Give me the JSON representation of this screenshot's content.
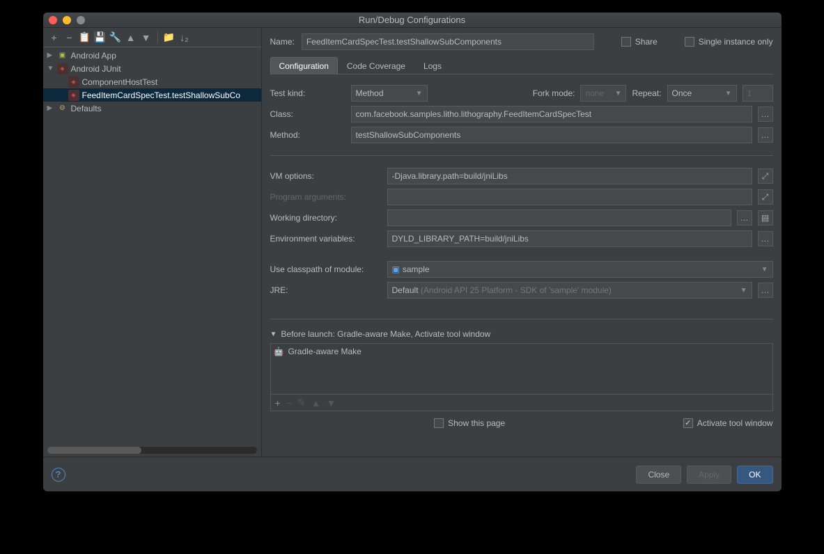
{
  "title": "Run/Debug Configurations",
  "toolbar": {},
  "tree": {
    "android_app": "Android App",
    "android_junit": "Android JUnit",
    "component_host_test": "ComponentHostTest",
    "selected_item": "FeedItemCardSpecTest.testShallowSubCo",
    "defaults": "Defaults"
  },
  "name_label": "Name:",
  "name_value": "FeedItemCardSpecTest.testShallowSubComponents",
  "share_label": "Share",
  "single_instance_label": "Single instance only",
  "tabs": {
    "configuration": "Configuration",
    "code_coverage": "Code Coverage",
    "logs": "Logs"
  },
  "form": {
    "test_kind_label": "Test kind:",
    "test_kind_value": "Method",
    "fork_mode_label": "Fork mode:",
    "fork_mode_value": "none",
    "repeat_label": "Repeat:",
    "repeat_value": "Once",
    "repeat_count": "1",
    "class_label": "Class:",
    "class_value": "com.facebook.samples.litho.lithography.FeedItemCardSpecTest",
    "method_label": "Method:",
    "method_value": "testShallowSubComponents",
    "vm_options_label": "VM options:",
    "vm_options_value": "-Djava.library.path=build/jniLibs",
    "program_args_label": "Program arguments:",
    "working_dir_label": "Working directory:",
    "env_vars_label": "Environment variables:",
    "env_vars_value": "DYLD_LIBRARY_PATH=build/jniLibs",
    "classpath_label": "Use classpath of module:",
    "classpath_value": "sample",
    "jre_label": "JRE:",
    "jre_value": "Default",
    "jre_hint": "(Android API 25 Platform - SDK of 'sample' module)"
  },
  "before_launch": {
    "header": "Before launch: Gradle-aware Make, Activate tool window",
    "item": "Gradle-aware Make",
    "show_page": "Show this page",
    "activate_window": "Activate tool window"
  },
  "footer": {
    "close": "Close",
    "apply": "Apply",
    "ok": "OK"
  }
}
